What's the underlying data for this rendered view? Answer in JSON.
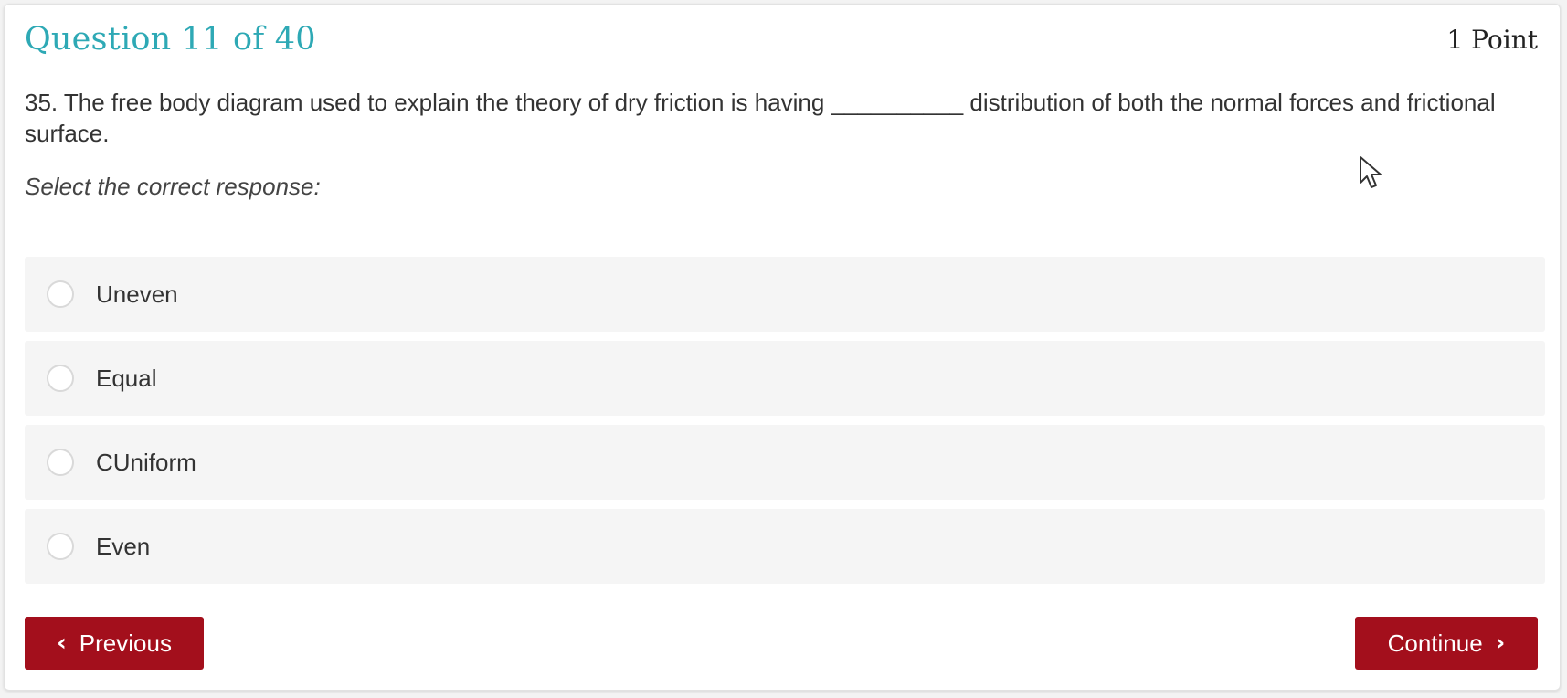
{
  "question": {
    "title": "Question 11 of 40",
    "points": "1 Point",
    "text": "35. The free body diagram used to explain the theory of dry friction is having __________ distribution of both the normal forces and frictional surface.",
    "instruction": "Select the correct response:"
  },
  "options": [
    {
      "label": "Uneven",
      "selected": false
    },
    {
      "label": "Equal",
      "selected": false
    },
    {
      "label": "CUniform",
      "selected": false
    },
    {
      "label": "Even",
      "selected": false
    }
  ],
  "nav": {
    "previous_label": "Previous",
    "continue_label": "Continue",
    "previous_icon": "chevron-left-icon",
    "continue_icon": "chevron-right-icon"
  },
  "colors": {
    "title": "#2ea9b5",
    "button": "#a30f1c",
    "option_bg": "#f5f5f5"
  }
}
